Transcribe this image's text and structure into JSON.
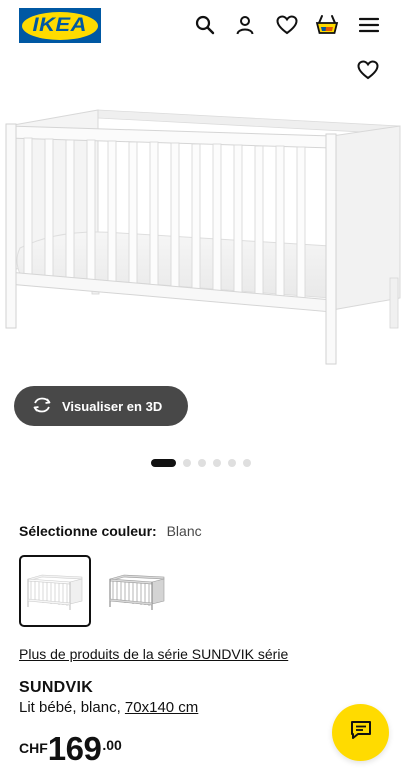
{
  "header": {
    "logo_text": "IKEA",
    "icons": [
      "search-icon",
      "account-icon",
      "wishlist-icon",
      "cart-icon",
      "menu-icon"
    ]
  },
  "gallery": {
    "visualise_label": "Visualiser en 3D",
    "image_count": 6,
    "current_image": 1
  },
  "color": {
    "label": "Sélectionne couleur:",
    "value": "Blanc",
    "options": [
      "white",
      "grey"
    ]
  },
  "series_link": "Plus de produits de la série SUNDVIK série",
  "product": {
    "name": "SUNDVIK",
    "description": "Lit bébé, blanc, ",
    "size": "70x140 cm"
  },
  "price": {
    "currency": "CHF",
    "amount": "169",
    "cents": ".00"
  },
  "colors": {
    "ikea_blue": "#0058a3",
    "ikea_yellow": "#ffdb00",
    "button_dark": "#484848"
  }
}
